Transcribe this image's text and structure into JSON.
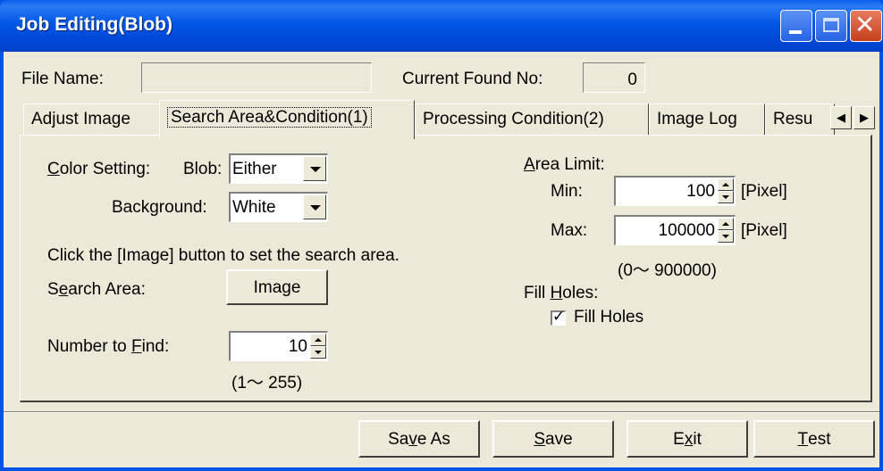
{
  "window": {
    "title": "Job Editing(Blob)"
  },
  "header": {
    "file_name_label": "File Name:",
    "file_name_value": "",
    "current_found_label": "Current Found No:",
    "current_found_value": "0"
  },
  "tabs": [
    {
      "label": "Adjust Image"
    },
    {
      "label": "Search Area&Condition(1)"
    },
    {
      "label": "Processing Condition(2)"
    },
    {
      "label": "Image Log"
    },
    {
      "label": "Resu"
    }
  ],
  "color_setting": {
    "label_prefix": "C",
    "label_rest": "olor Setting:",
    "blob_label": "Blob:",
    "blob_value": "Either",
    "background_label": "Background:",
    "background_value": "White"
  },
  "search": {
    "instruction": "Click the [Image] button to set the search area.",
    "area_label_a": "S",
    "area_label_u": "e",
    "area_label_b": "arch Area:",
    "image_button": "Image"
  },
  "number_to_find": {
    "label_a": "Number to ",
    "label_u": "F",
    "label_b": "ind:",
    "value": "10",
    "range": "(1〜 255)"
  },
  "area_limit": {
    "label_u": "A",
    "label_b": "rea Limit:",
    "min_label": "Min:",
    "min_value": "100",
    "max_label": "Max:",
    "max_value": "100000",
    "unit": "[Pixel]",
    "range": "(0〜 900000)"
  },
  "fill_holes": {
    "label_a": "Fill ",
    "label_u": "H",
    "label_b": "oles:",
    "checkbox_label": "Fill Holes",
    "checked": true
  },
  "footer": {
    "save_as_a": "Sa",
    "save_as_u": "v",
    "save_as_b": "e As",
    "save_u": "S",
    "save_b": "ave",
    "exit_a": "E",
    "exit_u": "x",
    "exit_b": "it",
    "test_u": "T",
    "test_b": "est"
  }
}
